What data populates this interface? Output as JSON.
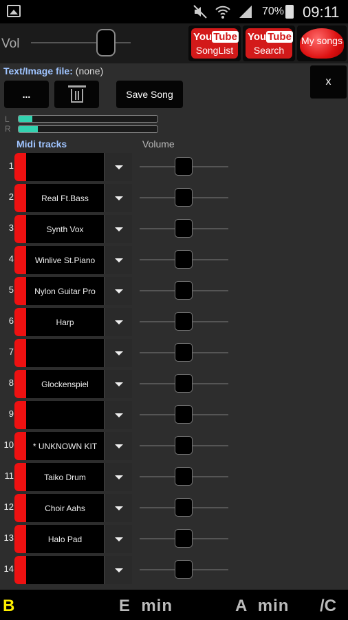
{
  "status_bar": {
    "battery": "70%",
    "time": "09:11"
  },
  "top": {
    "vol_label": "Vol",
    "songlist_button": {
      "brand_you": "You",
      "brand_tube": "Tube",
      "label": "SongList"
    },
    "search_button": {
      "brand_you": "You",
      "brand_tube": "Tube",
      "label": "Search"
    },
    "mysongs_button": {
      "label": "My songs"
    }
  },
  "panel": {
    "text_file_label": "Text/Image file:",
    "text_file_value": "(none)",
    "browse_label": "...",
    "save_label": "Save Song",
    "close_label": "x",
    "progress": [
      0.1,
      0.14
    ],
    "midi_tracks_label": "Midi tracks",
    "volume_label": "Volume"
  },
  "tracks": [
    {
      "num": "1",
      "name": ""
    },
    {
      "num": "2",
      "name": "Real Ft.Bass"
    },
    {
      "num": "3",
      "name": "Synth Vox"
    },
    {
      "num": "4",
      "name": "Winlive St.Piano"
    },
    {
      "num": "5",
      "name": "Nylon Guitar Pro"
    },
    {
      "num": "6",
      "name": "Harp"
    },
    {
      "num": "7",
      "name": ""
    },
    {
      "num": "8",
      "name": "Glockenspiel"
    },
    {
      "num": "9",
      "name": ""
    },
    {
      "num": "10",
      "name": "* UNKNOWN KIT"
    },
    {
      "num": "11",
      "name": "Taiko Drum"
    },
    {
      "num": "12",
      "name": "Choir Aahs"
    },
    {
      "num": "13",
      "name": "Halo Pad"
    },
    {
      "num": "14",
      "name": ""
    }
  ],
  "bottom": {
    "key1": "B",
    "key2": "E  min",
    "key3": "A  min",
    "key4": "/C"
  },
  "colors": {
    "accent_red": "#e11111",
    "progress": "#33d3b0",
    "label_blue": "#9fc4ff",
    "key_yellow": "#ffef00"
  }
}
